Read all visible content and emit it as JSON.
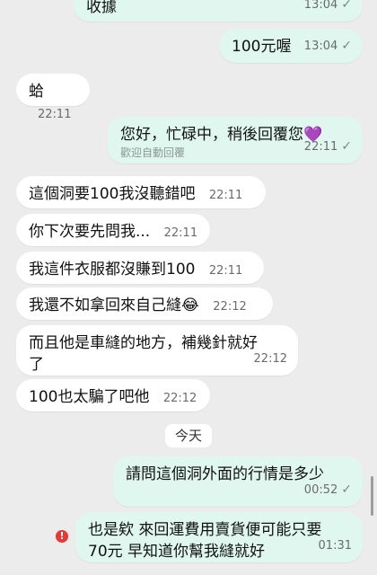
{
  "messages": [
    {
      "id": "m1",
      "dir": "out",
      "text": "收據",
      "time": "13:04",
      "read": true
    },
    {
      "id": "m2",
      "dir": "out",
      "text": "100元喔",
      "time": "13:04",
      "read": true
    },
    {
      "id": "m3",
      "dir": "in",
      "text": "蛤",
      "time": "22:11"
    },
    {
      "id": "m4",
      "dir": "out",
      "text": "您好，忙碌中，稍後回覆您💜",
      "sub": "歡迎自動回覆",
      "time": "22:11",
      "read": true
    },
    {
      "id": "m5",
      "dir": "in",
      "text": "這個洞要100我沒聽錯吧",
      "time": "22:11"
    },
    {
      "id": "m6",
      "dir": "in",
      "text": "你下次要先問我...",
      "time": "22:11"
    },
    {
      "id": "m7",
      "dir": "in",
      "text": "我這件衣服都沒賺到100",
      "time": "22:11"
    },
    {
      "id": "m8",
      "dir": "in",
      "text": "我還不如拿回來自己縫😂",
      "time": "22:12"
    },
    {
      "id": "m9",
      "dir": "in",
      "text": "而且他是車縫的地方，補幾針就好\n了",
      "time": "22:12"
    },
    {
      "id": "m10",
      "dir": "in",
      "text": "100也太騙了吧他",
      "time": "22:12"
    },
    {
      "id": "m11",
      "dir": "out",
      "text": "請問這個洞外面的行情是多少",
      "time": "00:52",
      "read": true
    },
    {
      "id": "m12",
      "dir": "out",
      "text": "也是欸 來回運費用賣貨便可能只要\n70元 早知道你幫我縫就好",
      "time": "01:31",
      "failed": true
    }
  ],
  "date_separator": "今天",
  "icons": {
    "read": "check-icon",
    "error": "error-icon"
  },
  "colors": {
    "incoming": "#ffffff",
    "outgoing": "#dff7ee",
    "background": "#ececec",
    "error": "#e53935"
  }
}
